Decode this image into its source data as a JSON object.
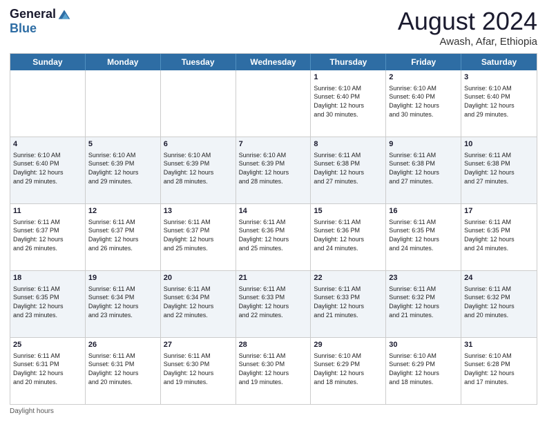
{
  "logo": {
    "general": "General",
    "blue": "Blue"
  },
  "title": "August 2024",
  "location": "Awash, Afar, Ethiopia",
  "days": [
    "Sunday",
    "Monday",
    "Tuesday",
    "Wednesday",
    "Thursday",
    "Friday",
    "Saturday"
  ],
  "footer": "Daylight hours",
  "weeks": [
    [
      {
        "day": "",
        "info": ""
      },
      {
        "day": "",
        "info": ""
      },
      {
        "day": "",
        "info": ""
      },
      {
        "day": "",
        "info": ""
      },
      {
        "day": "1",
        "info": "Sunrise: 6:10 AM\nSunset: 6:40 PM\nDaylight: 12 hours\nand 30 minutes."
      },
      {
        "day": "2",
        "info": "Sunrise: 6:10 AM\nSunset: 6:40 PM\nDaylight: 12 hours\nand 30 minutes."
      },
      {
        "day": "3",
        "info": "Sunrise: 6:10 AM\nSunset: 6:40 PM\nDaylight: 12 hours\nand 29 minutes."
      }
    ],
    [
      {
        "day": "4",
        "info": "Sunrise: 6:10 AM\nSunset: 6:40 PM\nDaylight: 12 hours\nand 29 minutes."
      },
      {
        "day": "5",
        "info": "Sunrise: 6:10 AM\nSunset: 6:39 PM\nDaylight: 12 hours\nand 29 minutes."
      },
      {
        "day": "6",
        "info": "Sunrise: 6:10 AM\nSunset: 6:39 PM\nDaylight: 12 hours\nand 28 minutes."
      },
      {
        "day": "7",
        "info": "Sunrise: 6:10 AM\nSunset: 6:39 PM\nDaylight: 12 hours\nand 28 minutes."
      },
      {
        "day": "8",
        "info": "Sunrise: 6:11 AM\nSunset: 6:38 PM\nDaylight: 12 hours\nand 27 minutes."
      },
      {
        "day": "9",
        "info": "Sunrise: 6:11 AM\nSunset: 6:38 PM\nDaylight: 12 hours\nand 27 minutes."
      },
      {
        "day": "10",
        "info": "Sunrise: 6:11 AM\nSunset: 6:38 PM\nDaylight: 12 hours\nand 27 minutes."
      }
    ],
    [
      {
        "day": "11",
        "info": "Sunrise: 6:11 AM\nSunset: 6:37 PM\nDaylight: 12 hours\nand 26 minutes."
      },
      {
        "day": "12",
        "info": "Sunrise: 6:11 AM\nSunset: 6:37 PM\nDaylight: 12 hours\nand 26 minutes."
      },
      {
        "day": "13",
        "info": "Sunrise: 6:11 AM\nSunset: 6:37 PM\nDaylight: 12 hours\nand 25 minutes."
      },
      {
        "day": "14",
        "info": "Sunrise: 6:11 AM\nSunset: 6:36 PM\nDaylight: 12 hours\nand 25 minutes."
      },
      {
        "day": "15",
        "info": "Sunrise: 6:11 AM\nSunset: 6:36 PM\nDaylight: 12 hours\nand 24 minutes."
      },
      {
        "day": "16",
        "info": "Sunrise: 6:11 AM\nSunset: 6:35 PM\nDaylight: 12 hours\nand 24 minutes."
      },
      {
        "day": "17",
        "info": "Sunrise: 6:11 AM\nSunset: 6:35 PM\nDaylight: 12 hours\nand 24 minutes."
      }
    ],
    [
      {
        "day": "18",
        "info": "Sunrise: 6:11 AM\nSunset: 6:35 PM\nDaylight: 12 hours\nand 23 minutes."
      },
      {
        "day": "19",
        "info": "Sunrise: 6:11 AM\nSunset: 6:34 PM\nDaylight: 12 hours\nand 23 minutes."
      },
      {
        "day": "20",
        "info": "Sunrise: 6:11 AM\nSunset: 6:34 PM\nDaylight: 12 hours\nand 22 minutes."
      },
      {
        "day": "21",
        "info": "Sunrise: 6:11 AM\nSunset: 6:33 PM\nDaylight: 12 hours\nand 22 minutes."
      },
      {
        "day": "22",
        "info": "Sunrise: 6:11 AM\nSunset: 6:33 PM\nDaylight: 12 hours\nand 21 minutes."
      },
      {
        "day": "23",
        "info": "Sunrise: 6:11 AM\nSunset: 6:32 PM\nDaylight: 12 hours\nand 21 minutes."
      },
      {
        "day": "24",
        "info": "Sunrise: 6:11 AM\nSunset: 6:32 PM\nDaylight: 12 hours\nand 20 minutes."
      }
    ],
    [
      {
        "day": "25",
        "info": "Sunrise: 6:11 AM\nSunset: 6:31 PM\nDaylight: 12 hours\nand 20 minutes."
      },
      {
        "day": "26",
        "info": "Sunrise: 6:11 AM\nSunset: 6:31 PM\nDaylight: 12 hours\nand 20 minutes."
      },
      {
        "day": "27",
        "info": "Sunrise: 6:11 AM\nSunset: 6:30 PM\nDaylight: 12 hours\nand 19 minutes."
      },
      {
        "day": "28",
        "info": "Sunrise: 6:11 AM\nSunset: 6:30 PM\nDaylight: 12 hours\nand 19 minutes."
      },
      {
        "day": "29",
        "info": "Sunrise: 6:10 AM\nSunset: 6:29 PM\nDaylight: 12 hours\nand 18 minutes."
      },
      {
        "day": "30",
        "info": "Sunrise: 6:10 AM\nSunset: 6:29 PM\nDaylight: 12 hours\nand 18 minutes."
      },
      {
        "day": "31",
        "info": "Sunrise: 6:10 AM\nSunset: 6:28 PM\nDaylight: 12 hours\nand 17 minutes."
      }
    ]
  ]
}
